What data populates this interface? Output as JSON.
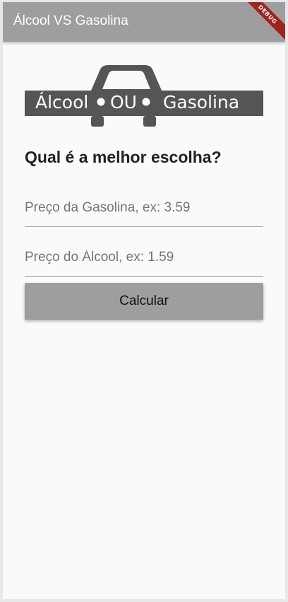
{
  "appbar": {
    "title": "Álcool VS Gasolina",
    "debug_banner": "DEBUG",
    "color": "#9e9e9e"
  },
  "logo": {
    "left_text": "Álcool",
    "middle_text": "OU",
    "right_text": "Gasolina",
    "color": "#555555"
  },
  "main": {
    "heading": "Qual é a melhor escolha?",
    "gasoline_field": {
      "placeholder": "Preço da Gasolina, ex: 3.59",
      "value": ""
    },
    "ethanol_field": {
      "placeholder": "Preço do Álcool, ex: 1.59",
      "value": ""
    },
    "calculate_label": "Calcular"
  }
}
